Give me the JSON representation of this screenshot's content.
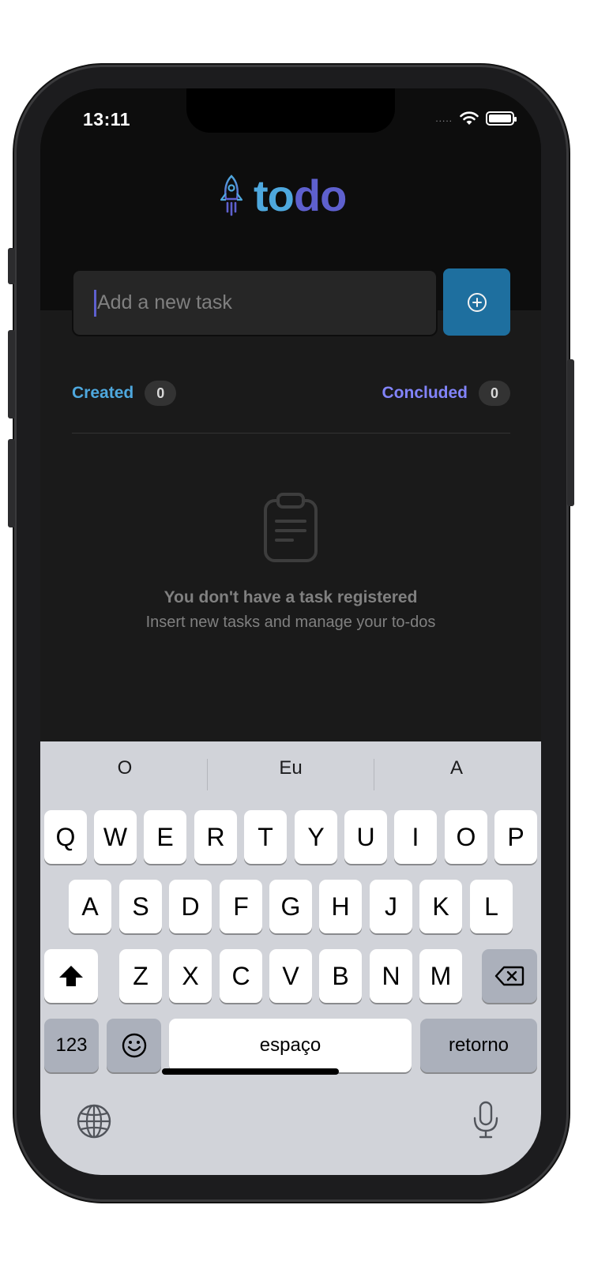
{
  "status_bar": {
    "time": "13:11",
    "signal": "....."
  },
  "logo": {
    "part1": "to",
    "part2": "do"
  },
  "task_input": {
    "placeholder": "Add a new task"
  },
  "counters": {
    "created": {
      "label": "Created",
      "count": "0"
    },
    "concluded": {
      "label": "Concluded",
      "count": "0"
    }
  },
  "empty_state": {
    "title": "You don't have a task registered",
    "subtitle": "Insert new tasks and manage your to-dos"
  },
  "keyboard": {
    "predictions": [
      "O",
      "Eu",
      "A"
    ],
    "row1": [
      "Q",
      "W",
      "E",
      "R",
      "T",
      "Y",
      "U",
      "I",
      "O",
      "P"
    ],
    "row2": [
      "A",
      "S",
      "D",
      "F",
      "G",
      "H",
      "J",
      "K",
      "L"
    ],
    "row3": [
      "Z",
      "X",
      "C",
      "V",
      "B",
      "N",
      "M"
    ],
    "numbers_label": "123",
    "space_label": "espaço",
    "return_label": "retorno"
  },
  "colors": {
    "blue": "#4ea8de",
    "purple": "#5e60ce",
    "button": "#1e6f9f"
  },
  "icons": [
    "rocket-icon",
    "plus-circle-icon",
    "clipboard-icon",
    "wifi-icon",
    "battery-icon",
    "shift-icon",
    "backspace-icon",
    "emoji-icon",
    "globe-icon",
    "microphone-icon"
  ]
}
